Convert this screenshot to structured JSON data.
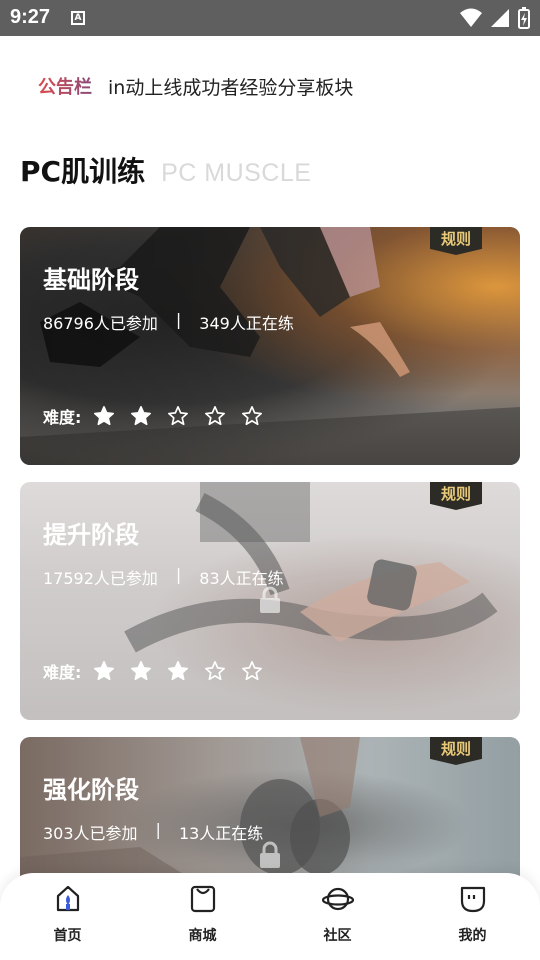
{
  "status_bar": {
    "time": "9:27",
    "notif_icon": "A"
  },
  "notice": {
    "logo": "公告栏",
    "text": "in动上线成功者经验分享板块"
  },
  "section": {
    "title": "PC肌训练",
    "subtitle": "PC MUSCLE"
  },
  "colors": {
    "badge_bg": "#2c2b26",
    "badge_text": "#e8c977",
    "nav_active": "#3b5bdb",
    "star_fill": "#ffffff"
  },
  "cards": [
    {
      "title": "基础阶段",
      "participants": "86796人已参加",
      "separator": "|",
      "active": "349人正在练",
      "difficulty_label": "难度:",
      "difficulty": 2,
      "max_difficulty": 5,
      "badge": "规则",
      "locked": false
    },
    {
      "title": "提升阶段",
      "participants": "17592人已参加",
      "separator": "|",
      "active": "83人正在练",
      "difficulty_label": "难度:",
      "difficulty": 3,
      "max_difficulty": 5,
      "badge": "规则",
      "locked": true
    },
    {
      "title": "强化阶段",
      "participants": "303人已参加",
      "separator": "|",
      "active": "13人正在练",
      "badge": "规则",
      "locked": true
    }
  ],
  "nav": [
    {
      "label": "首页",
      "icon": "home-icon",
      "active": true
    },
    {
      "label": "商城",
      "icon": "shop-bag-icon",
      "active": false
    },
    {
      "label": "社区",
      "icon": "planet-icon",
      "active": false
    },
    {
      "label": "我的",
      "icon": "profile-icon",
      "active": false
    }
  ]
}
